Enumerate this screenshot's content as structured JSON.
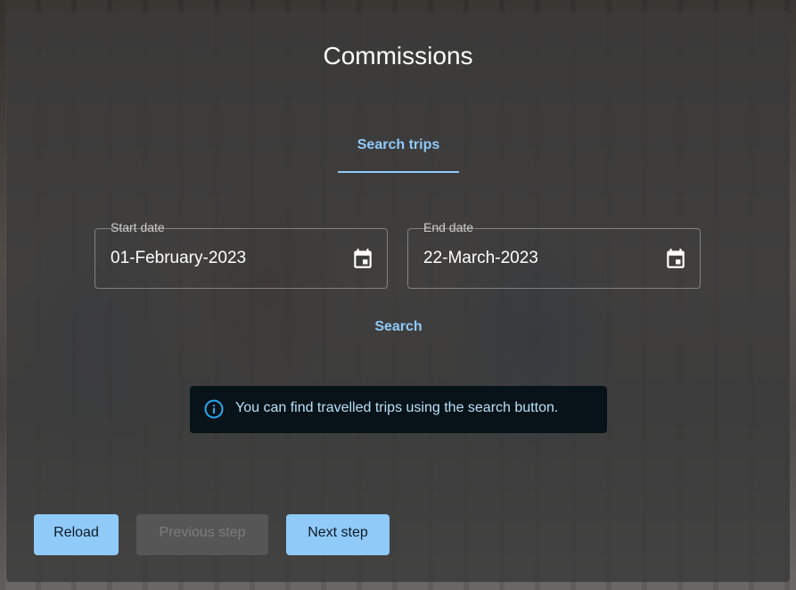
{
  "title": "Commissions",
  "tab": {
    "label": "Search trips"
  },
  "start_date": {
    "label": "Start date",
    "value": "01-February-2023"
  },
  "end_date": {
    "label": "End date",
    "value": "22-March-2023"
  },
  "search": {
    "label": "Search"
  },
  "info": {
    "message": "You can find travelled trips using the search button."
  },
  "buttons": {
    "reload": "Reload",
    "previous": "Previous step",
    "next": "Next step"
  },
  "colors": {
    "accent": "#90caf9",
    "card": "#3a3a3a",
    "info_bg": "#071319"
  },
  "icons": {
    "calendar": "calendar-icon",
    "info": "info-icon"
  }
}
